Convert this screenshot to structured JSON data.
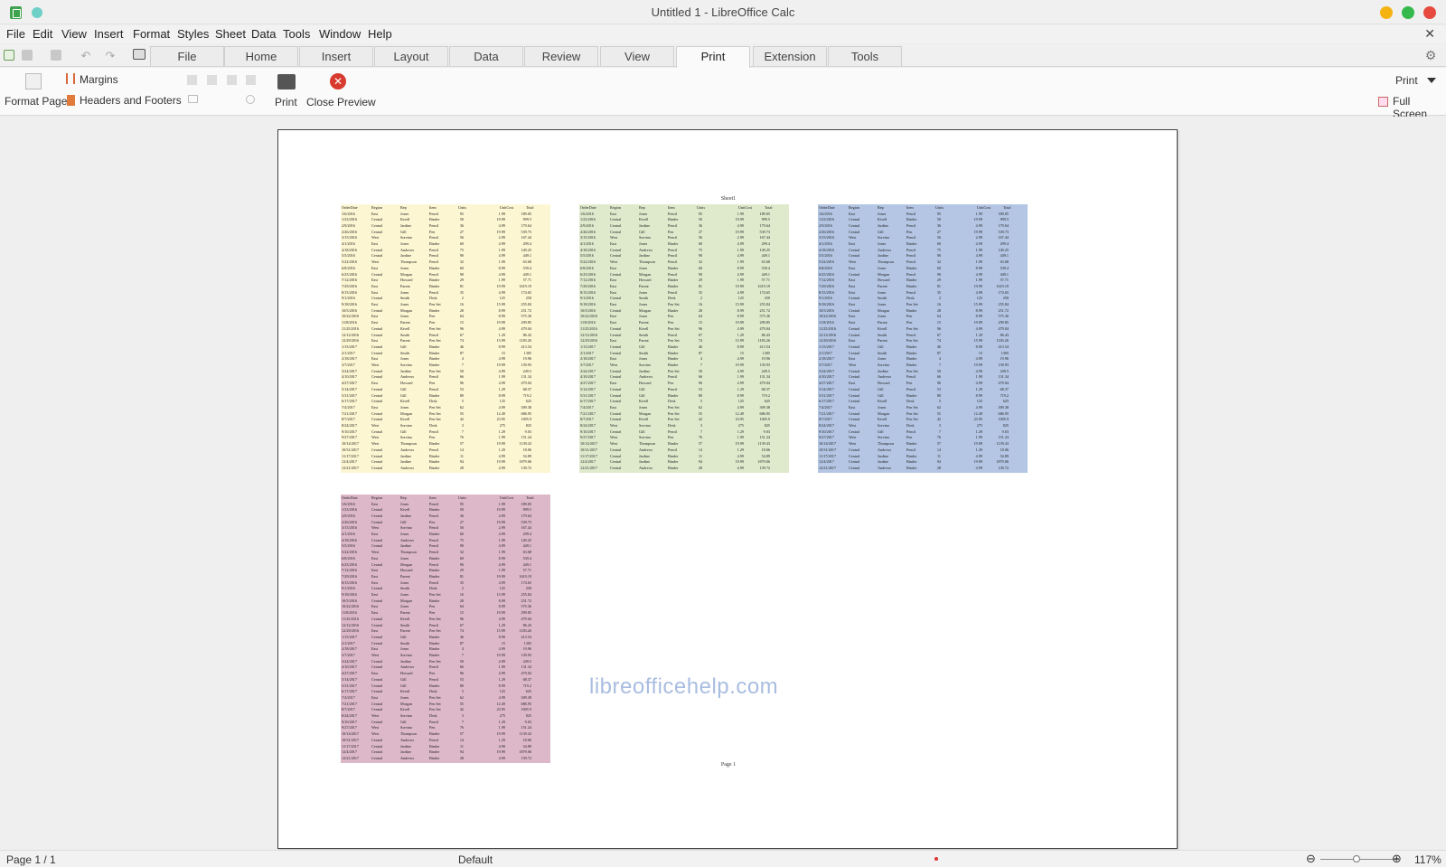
{
  "window": {
    "title": "Untitled 1 - LibreOffice Calc",
    "controls": {
      "minimize_color": "#f5b313",
      "maximize_color": "#35b94c",
      "close_color": "#e64a3f"
    }
  },
  "menubar": {
    "items": [
      "File",
      "Edit",
      "View",
      "Insert",
      "Format",
      "Styles",
      "Sheet",
      "Data",
      "Tools",
      "Window",
      "Help"
    ]
  },
  "tabs": {
    "items": [
      "File",
      "Home",
      "Insert",
      "Layout",
      "Data",
      "Review",
      "View",
      "Print",
      "Extension",
      "Tools"
    ],
    "active": "Print"
  },
  "ribbon": {
    "margins": "Margins",
    "format_page": "Format Page",
    "headers_footers": "Headers and Footers",
    "print": "Print",
    "close_preview": "Close Preview",
    "print_dropdown": "Print",
    "full_screen": "Full Screen"
  },
  "preview": {
    "sheet_name": "Sheet1",
    "page_footer": "Page 1",
    "watermark": "libreofficehelp.com",
    "table_colors": {
      "yellow": "#fdf6d2",
      "green": "#dfeacd",
      "blue": "#b4c6e4",
      "pink": "#ddb8c8"
    },
    "headers": [
      "OrderDate",
      "Region",
      "Rep",
      "Item",
      "Units",
      "UnitCost",
      "Total"
    ],
    "rows": [
      [
        "1/6/2016",
        "East",
        "Jones",
        "Pencil",
        "95",
        "1.99",
        "189.05"
      ],
      [
        "1/23/2016",
        "Central",
        "Kivell",
        "Binder",
        "50",
        "19.99",
        "999.5"
      ],
      [
        "2/9/2016",
        "Central",
        "Jardine",
        "Pencil",
        "36",
        "4.99",
        "179.64"
      ],
      [
        "2/26/2016",
        "Central",
        "Gill",
        "Pen",
        "27",
        "19.99",
        "539.73"
      ],
      [
        "3/15/2016",
        "West",
        "Sorvino",
        "Pencil",
        "56",
        "2.99",
        "167.44"
      ],
      [
        "4/1/2016",
        "East",
        "Jones",
        "Binder",
        "60",
        "4.99",
        "299.4"
      ],
      [
        "4/18/2016",
        "Central",
        "Andrews",
        "Pencil",
        "75",
        "1.99",
        "149.25"
      ],
      [
        "5/5/2016",
        "Central",
        "Jardine",
        "Pencil",
        "90",
        "4.99",
        "449.1"
      ],
      [
        "5/22/2016",
        "West",
        "Thompson",
        "Pencil",
        "32",
        "1.99",
        "63.68"
      ],
      [
        "6/8/2016",
        "East",
        "Jones",
        "Binder",
        "60",
        "8.99",
        "539.4"
      ],
      [
        "6/25/2016",
        "Central",
        "Morgan",
        "Pencil",
        "90",
        "4.99",
        "449.1"
      ],
      [
        "7/12/2016",
        "East",
        "Howard",
        "Binder",
        "29",
        "1.99",
        "57.71"
      ],
      [
        "7/29/2016",
        "East",
        "Parent",
        "Binder",
        "81",
        "19.99",
        "1619.19"
      ],
      [
        "8/15/2016",
        "East",
        "Jones",
        "Pencil",
        "35",
        "4.99",
        "174.65"
      ],
      [
        "9/1/2016",
        "Central",
        "Smith",
        "Desk",
        "2",
        "125",
        "250"
      ],
      [
        "9/18/2016",
        "East",
        "Jones",
        "Pen Set",
        "16",
        "15.99",
        "255.84"
      ],
      [
        "10/5/2016",
        "Central",
        "Morgan",
        "Binder",
        "28",
        "8.99",
        "251.72"
      ],
      [
        "10/22/2016",
        "East",
        "Jones",
        "Pen",
        "64",
        "8.99",
        "575.36"
      ],
      [
        "11/8/2016",
        "East",
        "Parent",
        "Pen",
        "15",
        "19.99",
        "299.85"
      ],
      [
        "11/25/2016",
        "Central",
        "Kivell",
        "Pen Set",
        "96",
        "4.99",
        "479.04"
      ],
      [
        "12/12/2016",
        "Central",
        "Smith",
        "Pencil",
        "67",
        "1.29",
        "86.43"
      ],
      [
        "12/29/2016",
        "East",
        "Parent",
        "Pen Set",
        "74",
        "15.99",
        "1183.26"
      ],
      [
        "1/15/2017",
        "Central",
        "Gill",
        "Binder",
        "46",
        "8.99",
        "413.54"
      ],
      [
        "2/1/2017",
        "Central",
        "Smith",
        "Binder",
        "87",
        "15",
        "1305"
      ],
      [
        "2/18/2017",
        "East",
        "Jones",
        "Binder",
        "4",
        "4.99",
        "19.96"
      ],
      [
        "3/7/2017",
        "West",
        "Sorvino",
        "Binder",
        "7",
        "19.99",
        "139.93"
      ],
      [
        "3/24/2017",
        "Central",
        "Jardine",
        "Pen Set",
        "50",
        "4.99",
        "249.5"
      ],
      [
        "4/10/2017",
        "Central",
        "Andrews",
        "Pencil",
        "66",
        "1.99",
        "131.34"
      ],
      [
        "4/27/2017",
        "East",
        "Howard",
        "Pen",
        "96",
        "4.99",
        "479.04"
      ],
      [
        "5/14/2017",
        "Central",
        "Gill",
        "Pencil",
        "53",
        "1.29",
        "68.37"
      ],
      [
        "5/31/2017",
        "Central",
        "Gill",
        "Binder",
        "80",
        "8.99",
        "719.2"
      ],
      [
        "6/17/2017",
        "Central",
        "Kivell",
        "Desk",
        "5",
        "125",
        "625"
      ],
      [
        "7/4/2017",
        "East",
        "Jones",
        "Pen Set",
        "62",
        "4.99",
        "309.38"
      ],
      [
        "7/21/2017",
        "Central",
        "Morgan",
        "Pen Set",
        "55",
        "12.49",
        "686.95"
      ],
      [
        "8/7/2017",
        "Central",
        "Kivell",
        "Pen Set",
        "42",
        "23.95",
        "1005.9"
      ],
      [
        "8/24/2017",
        "West",
        "Sorvino",
        "Desk",
        "3",
        "275",
        "825"
      ],
      [
        "9/10/2017",
        "Central",
        "Gill",
        "Pencil",
        "7",
        "1.29",
        "9.03"
      ],
      [
        "9/27/2017",
        "West",
        "Sorvino",
        "Pen",
        "76",
        "1.99",
        "151.24"
      ],
      [
        "10/14/2017",
        "West",
        "Thompson",
        "Binder",
        "57",
        "19.99",
        "1139.43"
      ],
      [
        "10/31/2017",
        "Central",
        "Andrews",
        "Pencil",
        "14",
        "1.29",
        "18.06"
      ],
      [
        "11/17/2017",
        "Central",
        "Jardine",
        "Binder",
        "11",
        "4.99",
        "54.89"
      ],
      [
        "12/4/2017",
        "Central",
        "Jardine",
        "Binder",
        "94",
        "19.99",
        "1879.06"
      ],
      [
        "12/21/2017",
        "Central",
        "Andrews",
        "Binder",
        "28",
        "4.99",
        "139.72"
      ]
    ]
  },
  "statusbar": {
    "page": "Page 1 / 1",
    "style": "Default",
    "zoom": "117%"
  }
}
